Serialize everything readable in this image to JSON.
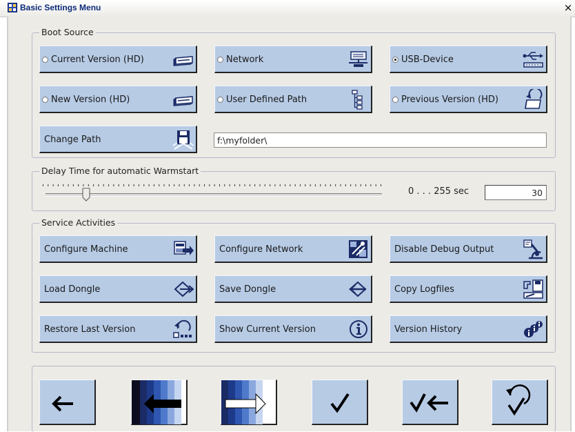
{
  "window": {
    "title": "Basic Settings Menu",
    "close_glyph": "×"
  },
  "boot_source": {
    "label": "Boot Source",
    "options": [
      {
        "label": "Current Version (HD)",
        "selected": false,
        "icon": "hard-disk-icon"
      },
      {
        "label": "Network",
        "selected": false,
        "icon": "network-icon"
      },
      {
        "label": "USB-Device",
        "selected": true,
        "icon": "usb-icon"
      },
      {
        "label": "New Version (HD)",
        "selected": false,
        "icon": "hard-disk-icon"
      },
      {
        "label": "User Defined Path",
        "selected": false,
        "icon": "folder-tree-icon"
      },
      {
        "label": "Previous Version (HD)",
        "selected": false,
        "icon": "folder-restore-icon"
      }
    ],
    "change_path_label": "Change Path",
    "change_path_icon": "floppy-disk-icon",
    "path_value": "f:\\myfolder\\"
  },
  "delay": {
    "label": "Delay Time for automatic Warmstart",
    "range_label": "0 . . . 255 sec",
    "value": "30",
    "slider_fraction": 0.12
  },
  "service": {
    "label": "Service Activities",
    "buttons": [
      {
        "label": "Configure Machine",
        "icon": "machine-config-icon"
      },
      {
        "label": "Configure Network",
        "icon": "network-config-icon"
      },
      {
        "label": "Disable Debug Output",
        "icon": "microscope-icon"
      },
      {
        "label": "Load Dongle",
        "icon": "dongle-load-icon"
      },
      {
        "label": "Save Dongle",
        "icon": "dongle-save-icon"
      },
      {
        "label": "Copy Logfiles",
        "icon": "copy-logfiles-icon"
      },
      {
        "label": "Restore Last Version",
        "icon": "restore-icon"
      },
      {
        "label": "Show Current Version",
        "icon": "info-icon"
      },
      {
        "label": "Version History",
        "icon": "version-history-icon"
      }
    ]
  },
  "nav": {
    "buttons": [
      {
        "icon": "back-arrow-icon"
      },
      {
        "icon": "previous-page-icon"
      },
      {
        "icon": "next-page-icon"
      },
      {
        "icon": "confirm-check-icon"
      },
      {
        "icon": "confirm-and-back-icon"
      },
      {
        "icon": "undo-check-icon"
      }
    ]
  },
  "colors": {
    "button_face": "#b7cbe5",
    "panel_bg": "#ecebe6",
    "title_text": "#0c2a78"
  }
}
